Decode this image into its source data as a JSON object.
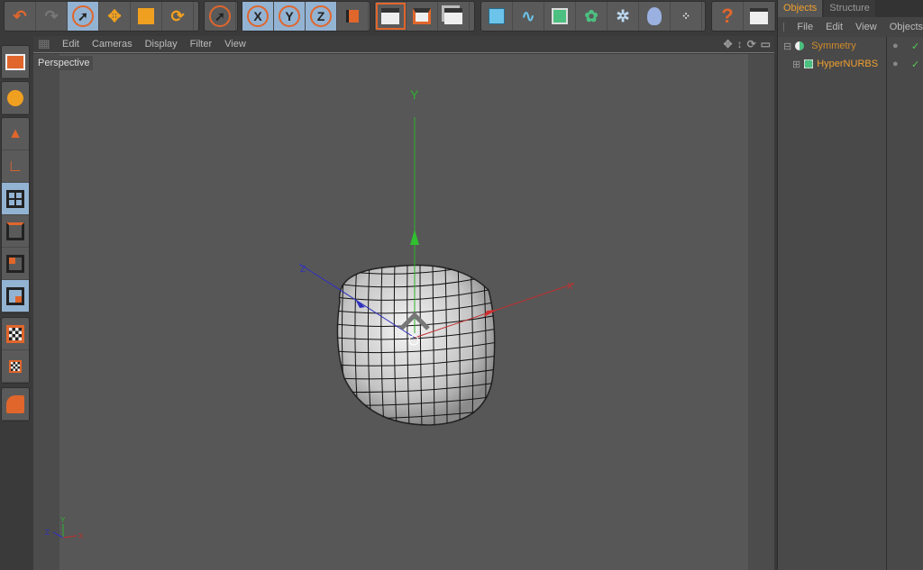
{
  "toolbar": {
    "groups": [
      {
        "items": [
          {
            "icon": "undo-icon"
          },
          {
            "icon": "redo-icon"
          },
          {
            "icon": "select-arrow-icon",
            "active": true
          },
          {
            "icon": "move-icon",
            "glyph": "✥"
          },
          {
            "icon": "scale-icon"
          },
          {
            "icon": "rotate-icon",
            "glyph": "⟳"
          }
        ]
      },
      {
        "items": [
          {
            "icon": "live-selection-icon"
          }
        ]
      },
      {
        "items": [
          {
            "icon": "x-axis-lock-icon",
            "glyph": "X"
          },
          {
            "icon": "y-axis-lock-icon",
            "glyph": "Y"
          },
          {
            "icon": "z-axis-lock-icon",
            "glyph": "Z"
          },
          {
            "icon": "coordinate-system-icon"
          }
        ]
      },
      {
        "items": [
          {
            "icon": "render-view-icon"
          },
          {
            "icon": "render-picture-viewer-icon"
          },
          {
            "icon": "render-settings-icon"
          }
        ]
      },
      {
        "items": [
          {
            "icon": "cube-primitive-icon"
          },
          {
            "icon": "spline-pen-icon"
          },
          {
            "icon": "nurbs-icon"
          },
          {
            "icon": "array-icon"
          },
          {
            "icon": "deformer-icon"
          },
          {
            "icon": "environment-icon"
          },
          {
            "icon": "particles-icon"
          }
        ]
      },
      {
        "items": [
          {
            "icon": "help-icon",
            "glyph": "?"
          },
          {
            "icon": "help-table-icon"
          }
        ]
      }
    ]
  },
  "left_toolbar": [
    "layout-icon",
    "convert-icon",
    "model-mode-icon",
    "object-axis-icon",
    "points-mode-icon",
    "edges-mode-icon",
    "polygons-mode-icon",
    "uvw-mode-icon",
    "texture-mode-icon",
    "workplane-icon",
    "primitives-icon"
  ],
  "viewport": {
    "menu": [
      "Edit",
      "Cameras",
      "Display",
      "Filter",
      "View"
    ],
    "camera_label": "Perspective",
    "axis_labels": {
      "y": "Y",
      "x": "X",
      "z": "Z"
    }
  },
  "objects_panel": {
    "tabs": [
      {
        "label": "Objects",
        "active": true
      },
      {
        "label": "Structure",
        "active": false
      }
    ],
    "menu": [
      "File",
      "Edit",
      "View",
      "Objects"
    ],
    "items": [
      {
        "name": "Symmetry",
        "color": "#d08a2a",
        "expanded": true
      },
      {
        "name": "HyperNURBS",
        "color": "#f0a030",
        "expanded": false
      }
    ]
  },
  "colors": {
    "accent": "#e0662c",
    "active_tool": "#93b3d3",
    "x_axis": "#d03030",
    "y_axis": "#30c030",
    "z_axis": "#3030c0"
  }
}
